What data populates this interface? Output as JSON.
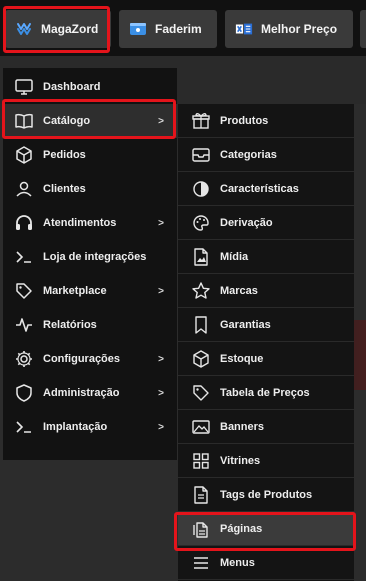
{
  "tabs": [
    {
      "label": "MagaZord",
      "icon": "magazord-logo-icon"
    },
    {
      "label": "Faderim",
      "icon": "faderim-window-icon"
    },
    {
      "label": "Melhor Preço",
      "icon": "melhor-preco-logo-icon"
    }
  ],
  "menu": {
    "items": [
      {
        "label": "Dashboard",
        "icon": "monitor-icon",
        "has_submenu": false
      },
      {
        "label": "Catálogo",
        "icon": "book-open-icon",
        "has_submenu": true,
        "chevron": ">"
      },
      {
        "label": "Pedidos",
        "icon": "box-icon",
        "has_submenu": false
      },
      {
        "label": "Clientes",
        "icon": "user-icon",
        "has_submenu": false
      },
      {
        "label": "Atendimentos",
        "icon": "headset-icon",
        "has_submenu": true,
        "chevron": ">"
      },
      {
        "label": "Loja de integrações",
        "icon": "terminal-icon",
        "has_submenu": false
      },
      {
        "label": "Marketplace",
        "icon": "tag-icon",
        "has_submenu": true,
        "chevron": ">"
      },
      {
        "label": "Relatórios",
        "icon": "activity-icon",
        "has_submenu": false
      },
      {
        "label": "Configurações",
        "icon": "gear-icon",
        "has_submenu": true,
        "chevron": ">"
      },
      {
        "label": "Administração",
        "icon": "shield-icon",
        "has_submenu": true,
        "chevron": ">"
      },
      {
        "label": "Implantação",
        "icon": "terminal-icon",
        "has_submenu": true,
        "chevron": ">"
      }
    ],
    "active": "Catálogo"
  },
  "submenu": {
    "items": [
      {
        "label": "Produtos",
        "icon": "gift-icon"
      },
      {
        "label": "Categorias",
        "icon": "inbox-icon"
      },
      {
        "label": "Características",
        "icon": "half-circle-icon"
      },
      {
        "label": "Derivação",
        "icon": "palette-icon"
      },
      {
        "label": "Mídia",
        "icon": "image-file-icon"
      },
      {
        "label": "Marcas",
        "icon": "star-icon"
      },
      {
        "label": "Garantias",
        "icon": "bookmark-icon"
      },
      {
        "label": "Estoque",
        "icon": "box-icon"
      },
      {
        "label": "Tabela de Preços",
        "icon": "tag-icon"
      },
      {
        "label": "Banners",
        "icon": "picture-icon"
      },
      {
        "label": "Vitrines",
        "icon": "grid-icon"
      },
      {
        "label": "Tags de Produtos",
        "icon": "document-icon"
      },
      {
        "label": "Páginas",
        "icon": "pages-icon"
      },
      {
        "label": "Menus",
        "icon": "menu-lines-icon"
      }
    ],
    "active": "Páginas"
  },
  "colors": {
    "highlight_box": "#e4141b",
    "menu_bg": "#121212",
    "tab_bg": "#3a3a3a",
    "icon_accent_blue": "#3b8fe5"
  }
}
